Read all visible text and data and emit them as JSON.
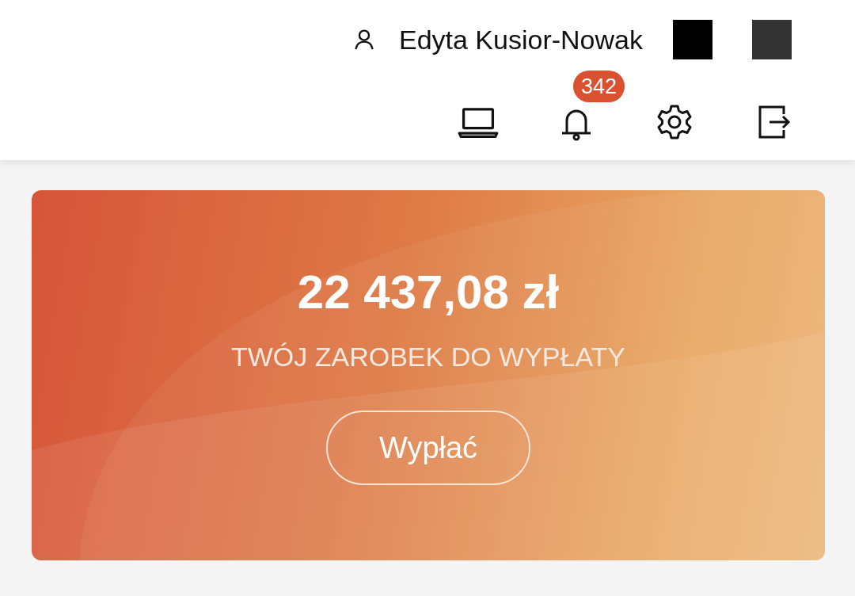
{
  "header": {
    "user_name": "Edyta Kusior-Nowak",
    "notifications_count": "342"
  },
  "earnings_card": {
    "amount": "22 437,08 zł",
    "label": "TWÓJ ZAROBEK DO WYPŁATY",
    "button": "Wypłać"
  }
}
